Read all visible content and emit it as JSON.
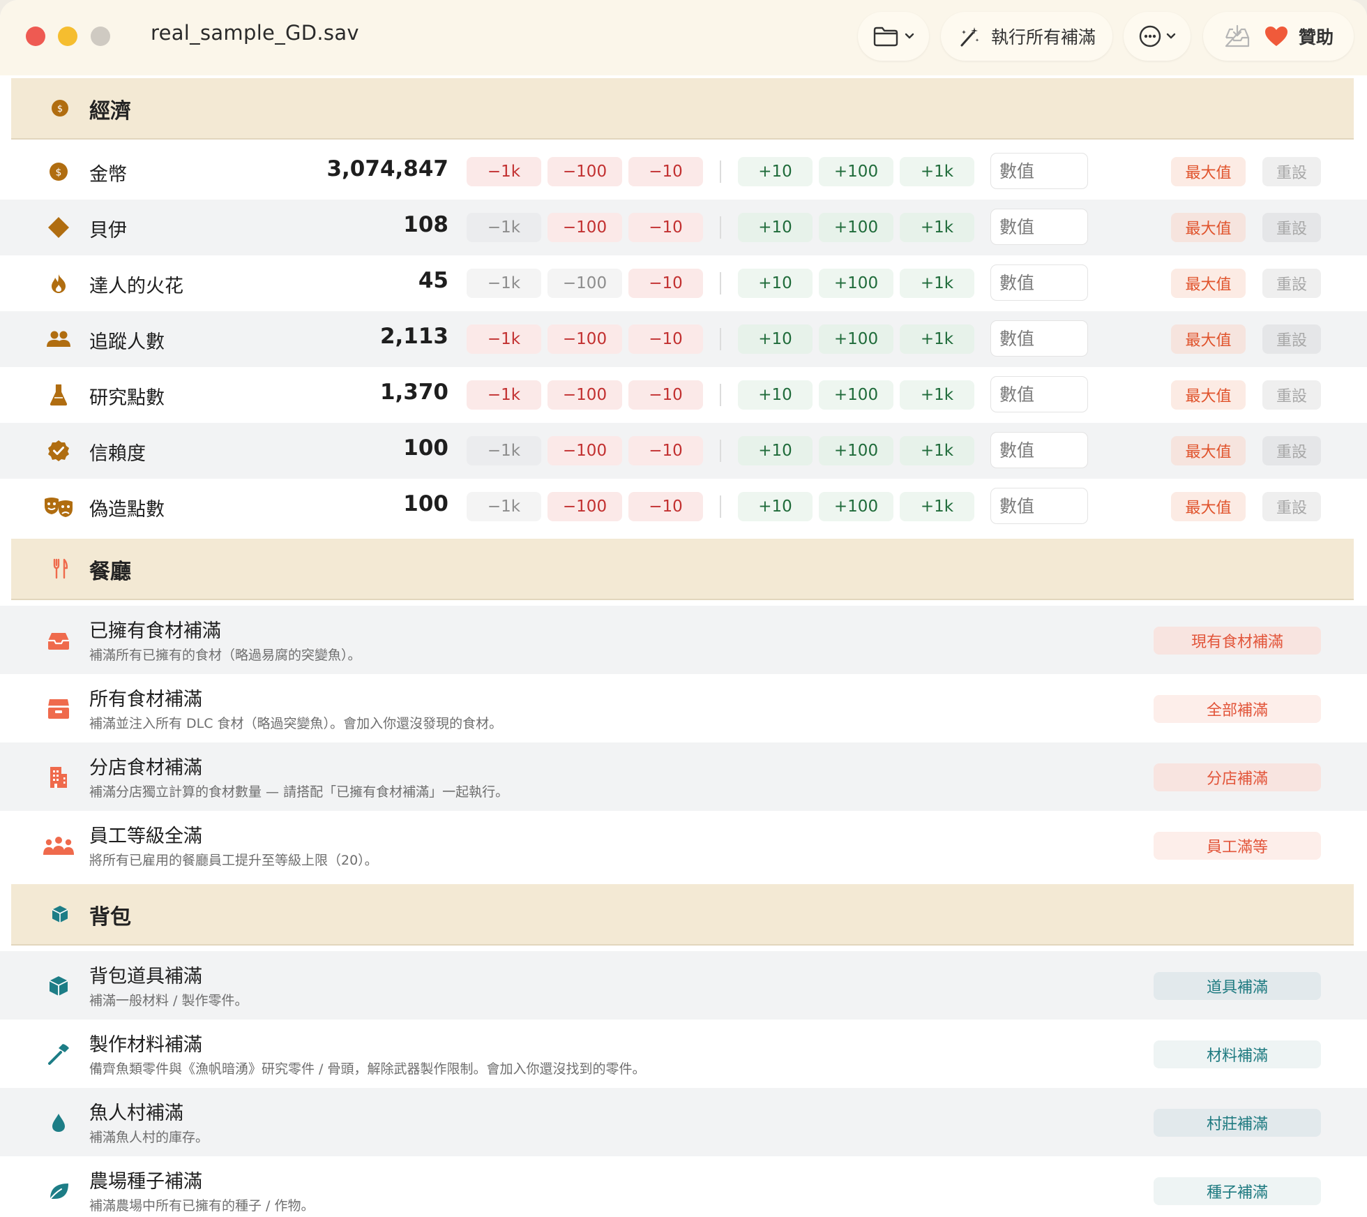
{
  "window": {
    "title": "real_sample_GD.sav"
  },
  "toolbar": {
    "fill_all_label": "執行所有補滿",
    "support_label": "贊助"
  },
  "colors": {
    "economy_icon": "#b06d10",
    "restaurant_icon": "#ef6a4c",
    "bag_icon": "#1d7d86",
    "header_bg": "#f3e9d4"
  },
  "sections": {
    "economy": {
      "title": "經濟",
      "icon": "coin-icon"
    },
    "restaurant": {
      "title": "餐廳",
      "icon": "fork-knife-icon"
    },
    "bag": {
      "title": "背包",
      "icon": "cube-icon"
    }
  },
  "labels": {
    "minus_1k": "−1k",
    "minus_100": "−100",
    "minus_10": "−10",
    "plus_10": "+10",
    "plus_100": "+100",
    "plus_1k": "+1k",
    "input_placeholder": "數值",
    "max": "最大值",
    "reset": "重設"
  },
  "stats": [
    {
      "label": "金幣",
      "value": "3,074,847",
      "icon": "coin-icon",
      "neg_enabled": [
        true,
        true,
        true
      ]
    },
    {
      "label": "貝伊",
      "value": "108",
      "icon": "diamond-icon",
      "neg_enabled": [
        false,
        true,
        true
      ]
    },
    {
      "label": "達人的火花",
      "value": "45",
      "icon": "flame-icon",
      "neg_enabled": [
        false,
        false,
        true
      ]
    },
    {
      "label": "追蹤人數",
      "value": "2,113",
      "icon": "people-icon",
      "neg_enabled": [
        true,
        true,
        true
      ]
    },
    {
      "label": "研究點數",
      "value": "1,370",
      "icon": "flask-icon",
      "neg_enabled": [
        true,
        true,
        true
      ]
    },
    {
      "label": "信賴度",
      "value": "100",
      "icon": "verified-badge-icon",
      "neg_enabled": [
        false,
        true,
        true
      ]
    },
    {
      "label": "偽造點數",
      "value": "100",
      "icon": "theater-masks-icon",
      "neg_enabled": [
        false,
        true,
        true
      ]
    }
  ],
  "restaurant_actions": [
    {
      "title": "已擁有食材補滿",
      "desc": "補滿所有已擁有的食材（略過易腐的突變魚）。",
      "button": "現有食材補滿",
      "icon": "tray-icon"
    },
    {
      "title": "所有食材補滿",
      "desc": "補滿並注入所有 DLC 食材（略過突變魚）。會加入你還沒發現的食材。",
      "button": "全部補滿",
      "icon": "box-stack-icon"
    },
    {
      "title": "分店食材補滿",
      "desc": "補滿分店獨立計算的食材數量 — 請搭配「已擁有食材補滿」一起執行。",
      "button": "分店補滿",
      "icon": "building-icon"
    },
    {
      "title": "員工等級全滿",
      "desc": "將所有已雇用的餐廳員工提升至等級上限（20）。",
      "button": "員工滿等",
      "icon": "group-icon"
    }
  ],
  "bag_actions": [
    {
      "title": "背包道具補滿",
      "desc": "補滿一般材料 / 製作零件。",
      "button": "道具補滿",
      "icon": "cube-icon"
    },
    {
      "title": "製作材料補滿",
      "desc": "備齊魚類零件與《漁帆暗湧》研究零件 / 骨頭，解除武器製作限制。會加入你還沒找到的零件。",
      "button": "材料補滿",
      "icon": "hammer-icon"
    },
    {
      "title": "魚人村補滿",
      "desc": "補滿魚人村的庫存。",
      "button": "村莊補滿",
      "icon": "water-drop-icon"
    },
    {
      "title": "農場種子補滿",
      "desc": "補滿農場中所有已擁有的種子 / 作物。",
      "button": "種子補滿",
      "icon": "leaf-icon"
    }
  ]
}
